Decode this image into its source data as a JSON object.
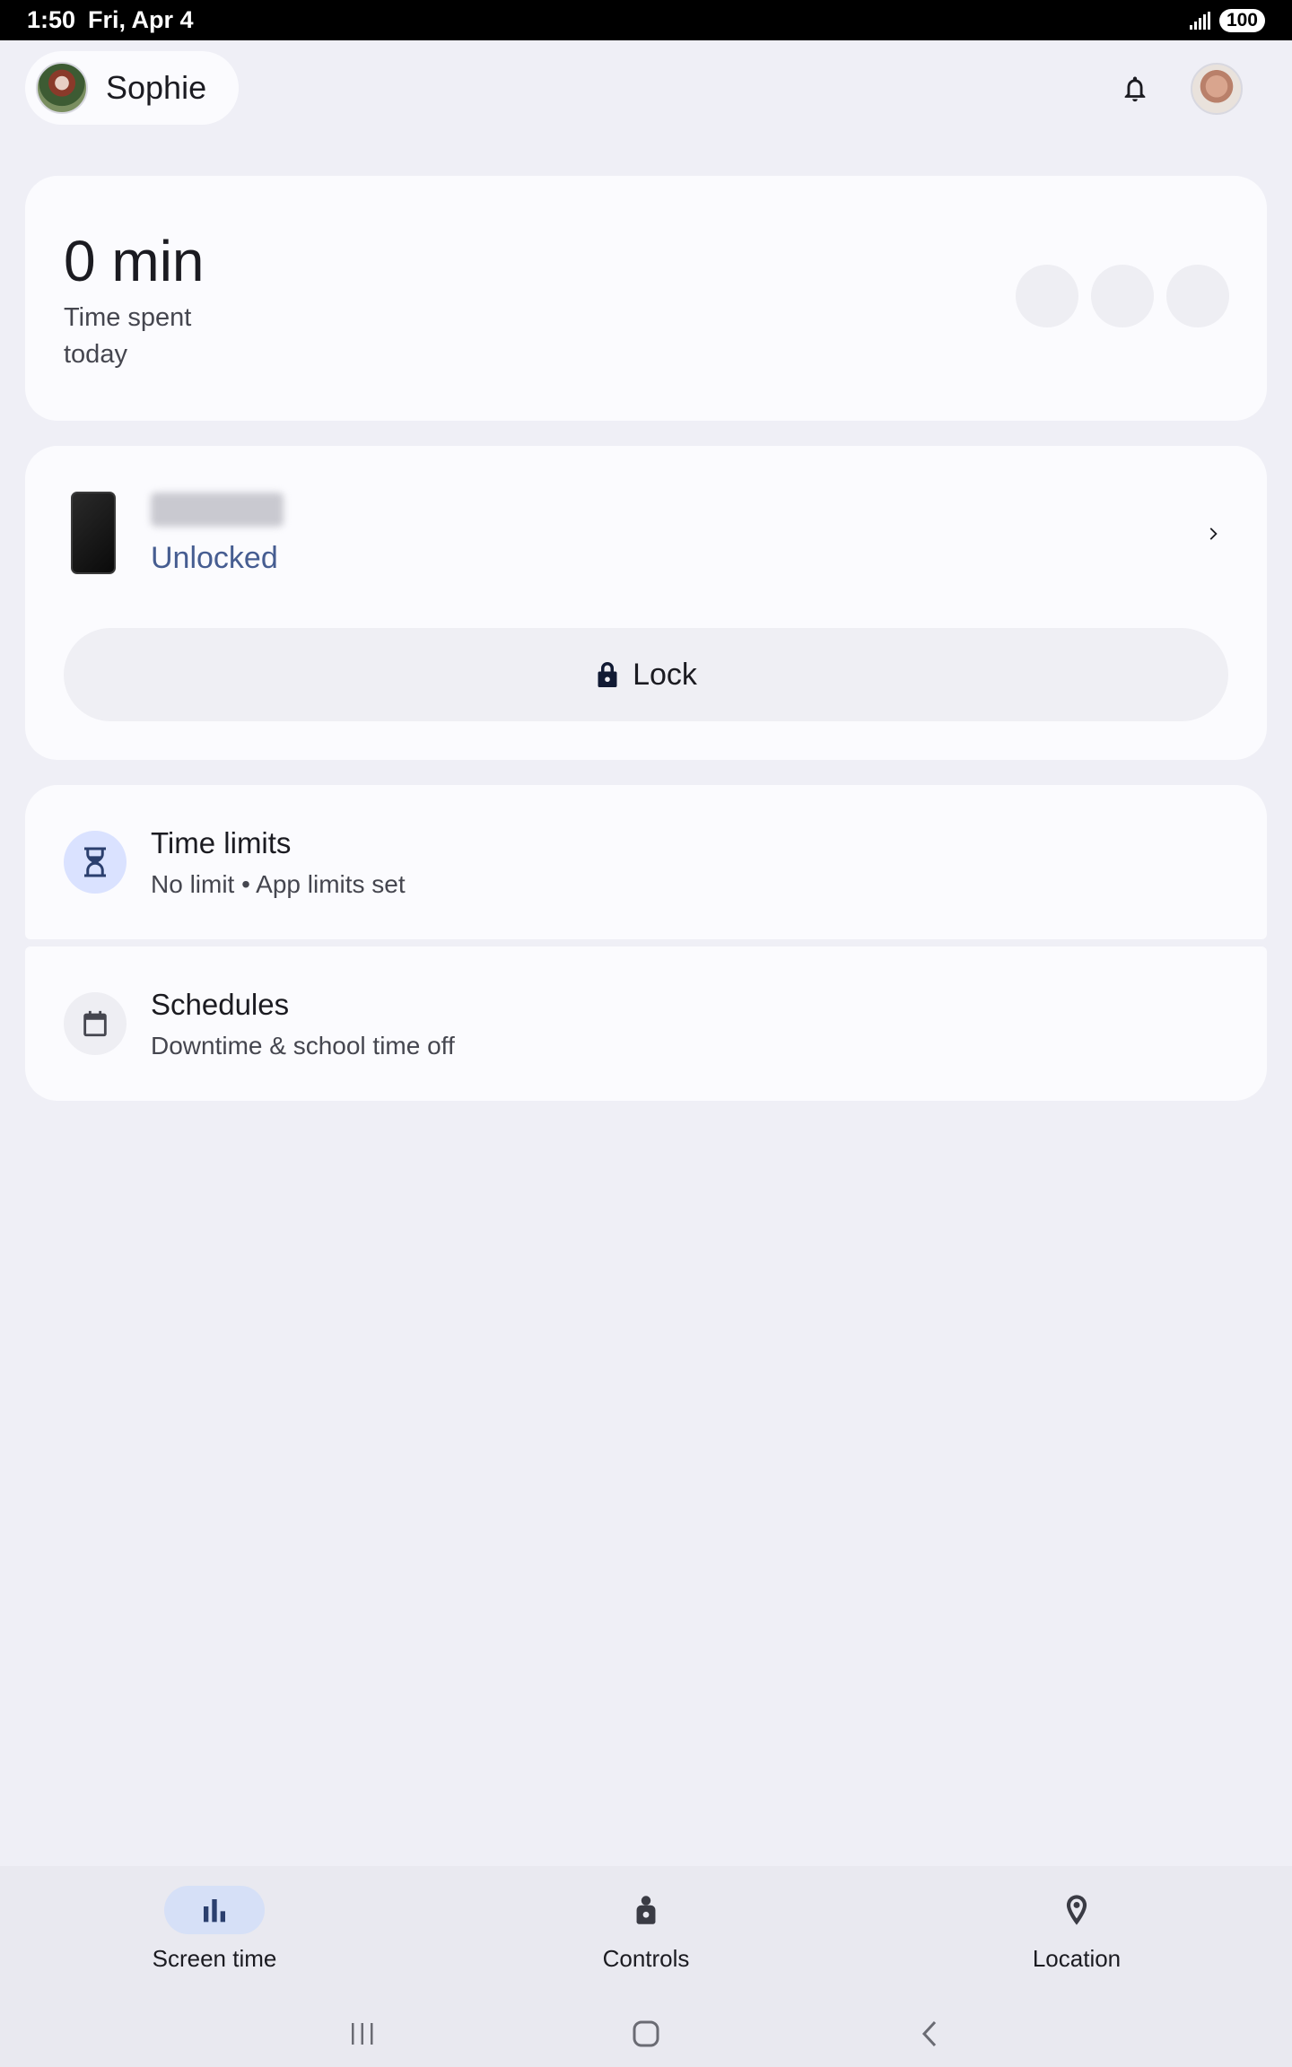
{
  "status_bar": {
    "time": "1:50",
    "date": "Fri, Apr 4",
    "battery": "100"
  },
  "header": {
    "child_name": "Sophie"
  },
  "time_card": {
    "value": "0 min",
    "label": "Time spent today"
  },
  "device_card": {
    "status": "Unlocked",
    "lock_label": "Lock"
  },
  "time_limits": {
    "title": "Time limits",
    "subtitle": "No limit • App limits set"
  },
  "schedules": {
    "title": "Schedules",
    "subtitle": "Downtime & school time off"
  },
  "bottom_nav": {
    "items": [
      {
        "label": "Screen time",
        "icon": "bar-chart-icon",
        "active": true
      },
      {
        "label": "Controls",
        "icon": "controls-icon",
        "active": false
      },
      {
        "label": "Location",
        "icon": "location-pin-icon",
        "active": false
      }
    ]
  },
  "colors": {
    "accent": "#465d91",
    "background": "#efeff6",
    "card": "#fbfbfe",
    "nav_active": "#d6e0f7"
  }
}
